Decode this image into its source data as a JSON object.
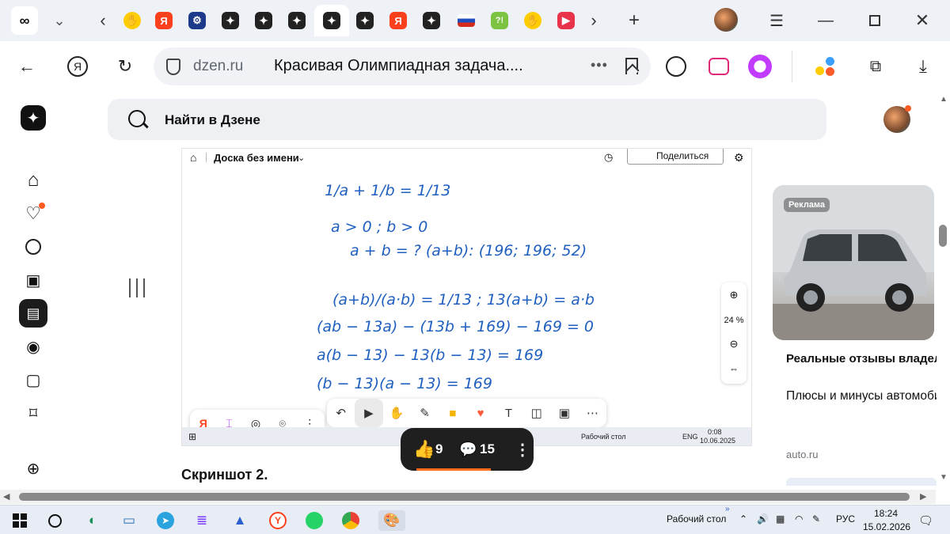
{
  "browser": {
    "infinity_label": "∞",
    "chevron_label": "⌄",
    "new_tab_label": "+",
    "yandex_letter": "Я",
    "tab_badge_green": "?!",
    "address": {
      "domain": "dzen.ru",
      "page_title": "Красивая Олимпиадная задача....",
      "more_label": "•••"
    }
  },
  "dzen": {
    "search_placeholder": "Найти в Дзене"
  },
  "screenshot": {
    "board_name": "Доска без имени",
    "share_label": "Поделиться",
    "zoom_level": "24 %",
    "math_lines": [
      "1/a + 1/b = 1/13",
      "a > 0 ;  b > 0",
      "a + b = ?      (a+b): (196; 196; 52)",
      "(a+b)/(a·b) = 1/13  ;  13(a+b) = a·b",
      "(ab − 13a) − (13b + 169) − 169 = 0",
      "a(b − 13) − 13(b − 13) = 169",
      "(b − 13)(a − 13) = 169"
    ],
    "taskbar": {
      "desktop_label": "Рабочий стол",
      "lang": "ENG",
      "time": "0:08",
      "date": "10.06.2025"
    }
  },
  "article": {
    "caption": "Скриншот 2."
  },
  "reactions": {
    "likes": "9",
    "comments": "15"
  },
  "ad": {
    "badge": "Реклама",
    "title": "Реальные отзывы владельцев Nissan X-Trail",
    "description": "Плюсы и минусы автомобиля Nissan! Читайте отзывы на Авто.ру",
    "domain": "auto.ru"
  },
  "taskbar": {
    "desktop_label": "Рабочий стол",
    "lang": "РУС",
    "time": "18:24",
    "date": "15.02.2026",
    "chevron": "»"
  },
  "colors": {
    "accent_orange": "#ff6b1a",
    "ink_blue": "#1f5fbf",
    "yandex_red": "#fc3f1d"
  }
}
